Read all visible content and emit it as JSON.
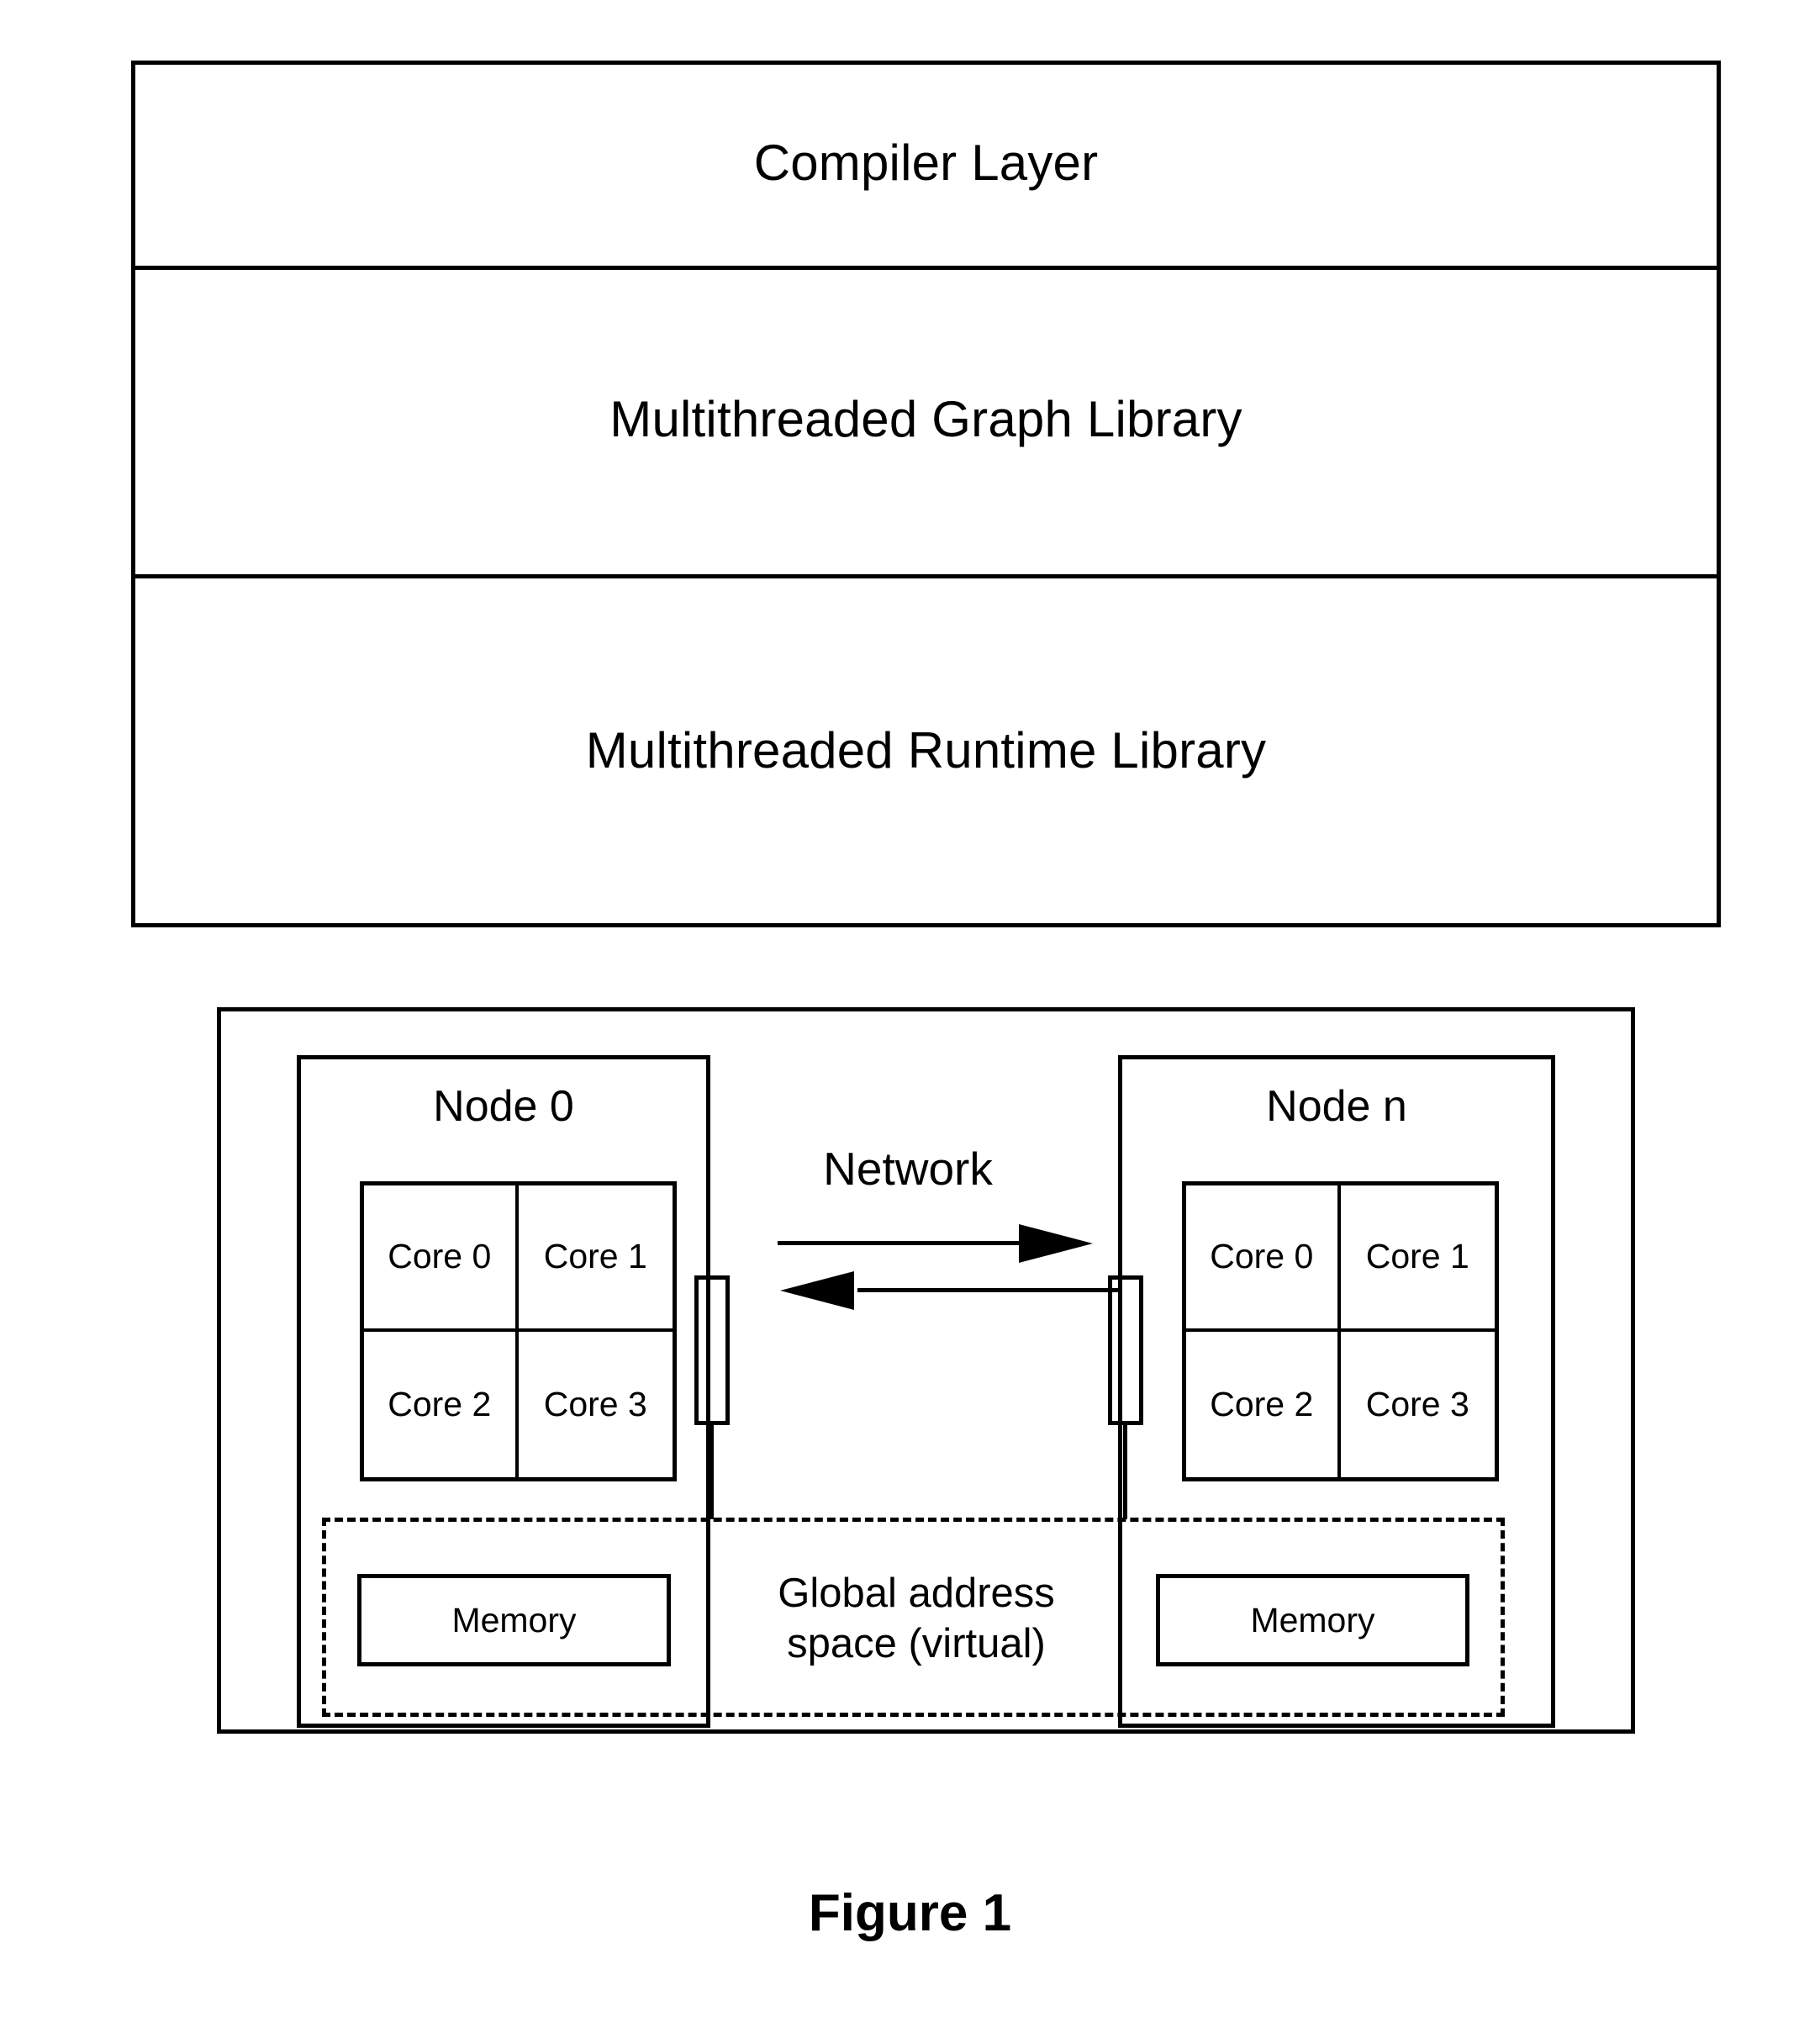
{
  "figure": {
    "caption": "Figure 1"
  },
  "software_stack": {
    "layers": [
      {
        "label": "Compiler Layer"
      },
      {
        "label": "Multithreaded Graph Library"
      },
      {
        "label": "Multithreaded Runtime Library"
      }
    ]
  },
  "hardware": {
    "network": {
      "label": "Network",
      "arrows": [
        {
          "direction": "right"
        },
        {
          "direction": "left"
        }
      ]
    },
    "global_address_space": {
      "label": "Global address\nspace (virtual)",
      "border_style": "dashed"
    },
    "nodes": [
      {
        "title": "Node 0",
        "cores": [
          "Core 0",
          "Core 1",
          "Core 2",
          "Core 3"
        ],
        "memory": "Memory"
      },
      {
        "title": "Node n",
        "cores": [
          "Core 0",
          "Core 1",
          "Core 2",
          "Core 3"
        ],
        "memory": "Memory"
      }
    ]
  },
  "colors": {
    "stroke": "#000000",
    "background": "#ffffff"
  }
}
